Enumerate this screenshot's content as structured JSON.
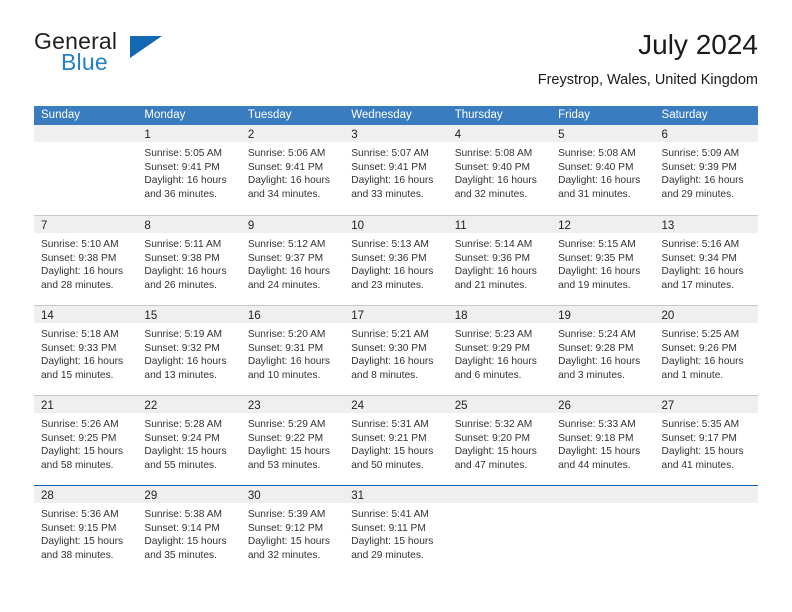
{
  "brand": {
    "name_top": "General",
    "name_bottom": "Blue",
    "triangle_color": "#1268b3",
    "blue_color": "#2581c4"
  },
  "header": {
    "title": "July 2024",
    "subtitle": "Freystrop, Wales, United Kingdom"
  },
  "theme": {
    "header_blue": "#3a7cc0",
    "day_band_gray": "#efefef",
    "row_divider": "#c8c8c8",
    "last_row_divider": "#1268b3"
  },
  "weekdays": [
    "Sunday",
    "Monday",
    "Tuesday",
    "Wednesday",
    "Thursday",
    "Friday",
    "Saturday"
  ],
  "weeks": [
    {
      "days": [
        {
          "number": "",
          "empty": true,
          "sunrise": "",
          "sunset": "",
          "daylight": ""
        },
        {
          "number": "1",
          "sunrise": "Sunrise: 5:05 AM",
          "sunset": "Sunset: 9:41 PM",
          "daylight": "Daylight: 16 hours and 36 minutes."
        },
        {
          "number": "2",
          "sunrise": "Sunrise: 5:06 AM",
          "sunset": "Sunset: 9:41 PM",
          "daylight": "Daylight: 16 hours and 34 minutes."
        },
        {
          "number": "3",
          "sunrise": "Sunrise: 5:07 AM",
          "sunset": "Sunset: 9:41 PM",
          "daylight": "Daylight: 16 hours and 33 minutes."
        },
        {
          "number": "4",
          "sunrise": "Sunrise: 5:08 AM",
          "sunset": "Sunset: 9:40 PM",
          "daylight": "Daylight: 16 hours and 32 minutes."
        },
        {
          "number": "5",
          "sunrise": "Sunrise: 5:08 AM",
          "sunset": "Sunset: 9:40 PM",
          "daylight": "Daylight: 16 hours and 31 minutes."
        },
        {
          "number": "6",
          "sunrise": "Sunrise: 5:09 AM",
          "sunset": "Sunset: 9:39 PM",
          "daylight": "Daylight: 16 hours and 29 minutes."
        }
      ]
    },
    {
      "days": [
        {
          "number": "7",
          "sunrise": "Sunrise: 5:10 AM",
          "sunset": "Sunset: 9:38 PM",
          "daylight": "Daylight: 16 hours and 28 minutes."
        },
        {
          "number": "8",
          "sunrise": "Sunrise: 5:11 AM",
          "sunset": "Sunset: 9:38 PM",
          "daylight": "Daylight: 16 hours and 26 minutes."
        },
        {
          "number": "9",
          "sunrise": "Sunrise: 5:12 AM",
          "sunset": "Sunset: 9:37 PM",
          "daylight": "Daylight: 16 hours and 24 minutes."
        },
        {
          "number": "10",
          "sunrise": "Sunrise: 5:13 AM",
          "sunset": "Sunset: 9:36 PM",
          "daylight": "Daylight: 16 hours and 23 minutes."
        },
        {
          "number": "11",
          "sunrise": "Sunrise: 5:14 AM",
          "sunset": "Sunset: 9:36 PM",
          "daylight": "Daylight: 16 hours and 21 minutes."
        },
        {
          "number": "12",
          "sunrise": "Sunrise: 5:15 AM",
          "sunset": "Sunset: 9:35 PM",
          "daylight": "Daylight: 16 hours and 19 minutes."
        },
        {
          "number": "13",
          "sunrise": "Sunrise: 5:16 AM",
          "sunset": "Sunset: 9:34 PM",
          "daylight": "Daylight: 16 hours and 17 minutes."
        }
      ]
    },
    {
      "days": [
        {
          "number": "14",
          "sunrise": "Sunrise: 5:18 AM",
          "sunset": "Sunset: 9:33 PM",
          "daylight": "Daylight: 16 hours and 15 minutes."
        },
        {
          "number": "15",
          "sunrise": "Sunrise: 5:19 AM",
          "sunset": "Sunset: 9:32 PM",
          "daylight": "Daylight: 16 hours and 13 minutes."
        },
        {
          "number": "16",
          "sunrise": "Sunrise: 5:20 AM",
          "sunset": "Sunset: 9:31 PM",
          "daylight": "Daylight: 16 hours and 10 minutes."
        },
        {
          "number": "17",
          "sunrise": "Sunrise: 5:21 AM",
          "sunset": "Sunset: 9:30 PM",
          "daylight": "Daylight: 16 hours and 8 minutes."
        },
        {
          "number": "18",
          "sunrise": "Sunrise: 5:23 AM",
          "sunset": "Sunset: 9:29 PM",
          "daylight": "Daylight: 16 hours and 6 minutes."
        },
        {
          "number": "19",
          "sunrise": "Sunrise: 5:24 AM",
          "sunset": "Sunset: 9:28 PM",
          "daylight": "Daylight: 16 hours and 3 minutes."
        },
        {
          "number": "20",
          "sunrise": "Sunrise: 5:25 AM",
          "sunset": "Sunset: 9:26 PM",
          "daylight": "Daylight: 16 hours and 1 minute."
        }
      ]
    },
    {
      "days": [
        {
          "number": "21",
          "sunrise": "Sunrise: 5:26 AM",
          "sunset": "Sunset: 9:25 PM",
          "daylight": "Daylight: 15 hours and 58 minutes."
        },
        {
          "number": "22",
          "sunrise": "Sunrise: 5:28 AM",
          "sunset": "Sunset: 9:24 PM",
          "daylight": "Daylight: 15 hours and 55 minutes."
        },
        {
          "number": "23",
          "sunrise": "Sunrise: 5:29 AM",
          "sunset": "Sunset: 9:22 PM",
          "daylight": "Daylight: 15 hours and 53 minutes."
        },
        {
          "number": "24",
          "sunrise": "Sunrise: 5:31 AM",
          "sunset": "Sunset: 9:21 PM",
          "daylight": "Daylight: 15 hours and 50 minutes."
        },
        {
          "number": "25",
          "sunrise": "Sunrise: 5:32 AM",
          "sunset": "Sunset: 9:20 PM",
          "daylight": "Daylight: 15 hours and 47 minutes."
        },
        {
          "number": "26",
          "sunrise": "Sunrise: 5:33 AM",
          "sunset": "Sunset: 9:18 PM",
          "daylight": "Daylight: 15 hours and 44 minutes."
        },
        {
          "number": "27",
          "sunrise": "Sunrise: 5:35 AM",
          "sunset": "Sunset: 9:17 PM",
          "daylight": "Daylight: 15 hours and 41 minutes."
        }
      ]
    },
    {
      "days": [
        {
          "number": "28",
          "sunrise": "Sunrise: 5:36 AM",
          "sunset": "Sunset: 9:15 PM",
          "daylight": "Daylight: 15 hours and 38 minutes."
        },
        {
          "number": "29",
          "sunrise": "Sunrise: 5:38 AM",
          "sunset": "Sunset: 9:14 PM",
          "daylight": "Daylight: 15 hours and 35 minutes."
        },
        {
          "number": "30",
          "sunrise": "Sunrise: 5:39 AM",
          "sunset": "Sunset: 9:12 PM",
          "daylight": "Daylight: 15 hours and 32 minutes."
        },
        {
          "number": "31",
          "sunrise": "Sunrise: 5:41 AM",
          "sunset": "Sunset: 9:11 PM",
          "daylight": "Daylight: 15 hours and 29 minutes."
        },
        {
          "number": "",
          "empty": true,
          "sunrise": "",
          "sunset": "",
          "daylight": ""
        },
        {
          "number": "",
          "empty": true,
          "sunrise": "",
          "sunset": "",
          "daylight": ""
        },
        {
          "number": "",
          "empty": true,
          "sunrise": "",
          "sunset": "",
          "daylight": ""
        }
      ]
    }
  ]
}
